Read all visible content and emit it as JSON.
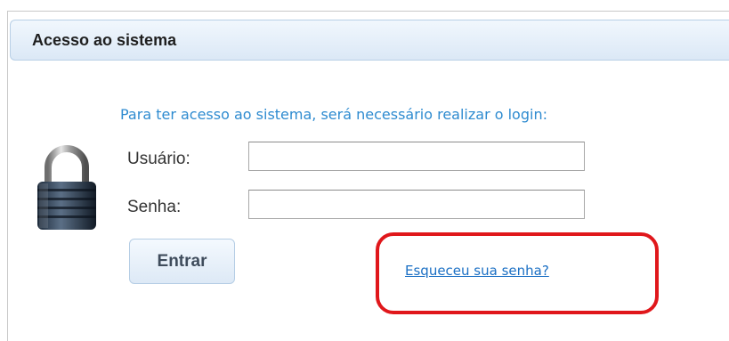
{
  "panel": {
    "title": "Acesso ao sistema"
  },
  "login": {
    "instruction": "Para ter acesso ao sistema, será necessário realizar o login:",
    "username_label": "Usuário:",
    "username_value": "",
    "password_label": "Senha:",
    "password_value": "",
    "submit_label": "Entrar",
    "forgot_password_link": "Esqueceu sua senha?"
  },
  "icons": {
    "lock": "padlock-icon"
  },
  "colors": {
    "header_bg": "#dbe8f6",
    "instruction_text": "#2e8bd0",
    "link": "#1a6fc4",
    "highlight_border": "#e0171b"
  }
}
